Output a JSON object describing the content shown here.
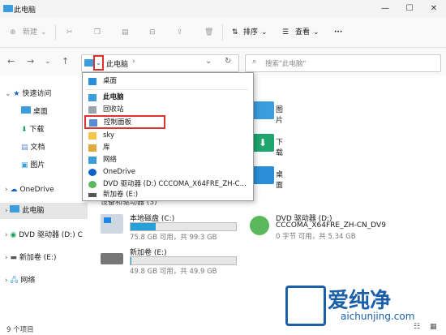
{
  "window": {
    "title": "此电脑",
    "controls": [
      "—",
      "☐",
      "✕"
    ]
  },
  "toolbar": {
    "new_label": "新建",
    "sort_label": "排序",
    "view_label": "查看",
    "more_label": "···"
  },
  "address": {
    "current": "此电脑",
    "search_placeholder": "搜索\"此电脑\""
  },
  "sidebar": {
    "items": [
      {
        "label": "快速访问"
      },
      {
        "label": "桌面"
      },
      {
        "label": "下载"
      },
      {
        "label": "文档"
      },
      {
        "label": "图片"
      },
      {
        "label": "OneDrive"
      },
      {
        "label": "此电脑"
      },
      {
        "label": "DVD 驱动器 (D:) C"
      },
      {
        "label": "新加卷 (E:)"
      },
      {
        "label": "网络"
      }
    ]
  },
  "dropdown": {
    "items": [
      {
        "label": "桌面",
        "icon": "desktop-icon"
      },
      {
        "label": "此电脑",
        "icon": "pc-icon"
      },
      {
        "label": "回收站",
        "icon": "recycle-bin-icon"
      },
      {
        "label": "控制面板",
        "icon": "control-panel-icon"
      },
      {
        "label": "sky",
        "icon": "user-folder-icon"
      },
      {
        "label": "库",
        "icon": "library-icon"
      },
      {
        "label": "网络",
        "icon": "network-icon"
      },
      {
        "label": "OneDrive",
        "icon": "cloud-icon"
      },
      {
        "label": "DVD 驱动器 (D:) CCCOMA_X64FRE_ZH-C...",
        "icon": "dvd-icon"
      },
      {
        "label": "新加卷 (E:)",
        "icon": "drive-icon"
      }
    ]
  },
  "folders": [
    {
      "label": "图片"
    },
    {
      "label": "下载"
    },
    {
      "label": "桌面"
    }
  ],
  "devices_header": "设备和驱动器 (3)",
  "drives": [
    {
      "name": "本地磁盘 (C:)",
      "space": "75.8 GB 可用，共 99.3 GB",
      "used_fraction": 0.24
    },
    {
      "name": "新加卷 (E:)",
      "space": "49.8 GB 可用，共 49.9 GB",
      "used_fraction": 0.01
    },
    {
      "name": "DVD 驱动器 (D:)",
      "name2": "CCCOMA_X64FRE_ZH-CN_DV9",
      "space": "0 字节 可用，共 5.34 GB"
    }
  ],
  "status": "9 个项目",
  "watermark": {
    "brand": "爱纯净",
    "url": "aichunjing.com"
  },
  "colors": {
    "accent": "#0a64c8",
    "highlight": "#e03131",
    "drive_fill": "#26a0da"
  }
}
